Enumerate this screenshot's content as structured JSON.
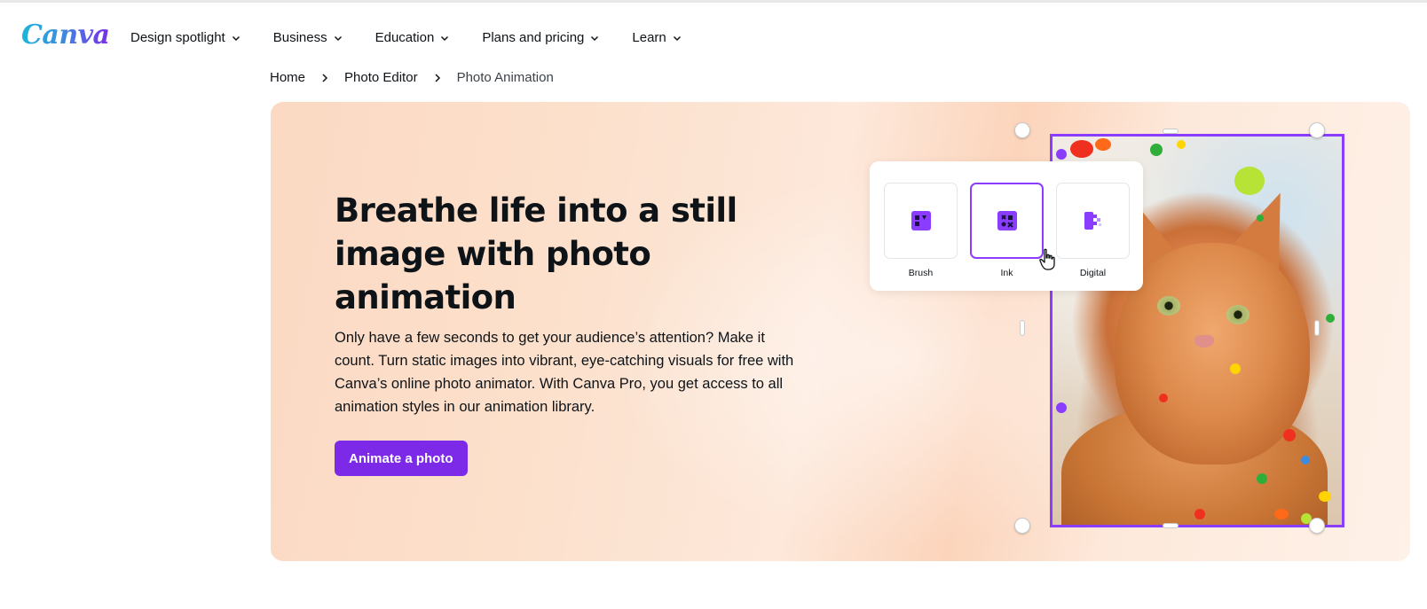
{
  "header": {
    "logo_text": "Canva",
    "nav": [
      {
        "label": "Design spotlight"
      },
      {
        "label": "Business"
      },
      {
        "label": "Education"
      },
      {
        "label": "Plans and pricing"
      },
      {
        "label": "Learn"
      }
    ]
  },
  "breadcrumb": [
    {
      "label": "Home"
    },
    {
      "label": "Photo Editor"
    },
    {
      "label": "Photo Animation"
    }
  ],
  "hero": {
    "title": "Breathe life into a still image with photo animation",
    "description": "Only have a few seconds to get your audience’s attention? Make it count. Turn static images into vibrant, eye-catching visuals for free with Canva’s online photo animator. With Canva Pro, you get access to all animation styles in our animation library.",
    "cta_label": "Animate a photo"
  },
  "animation_styles": {
    "selected": "Ink",
    "options": [
      {
        "label": "Brush",
        "icon": "brush-style-icon"
      },
      {
        "label": "Ink",
        "icon": "ink-style-icon"
      },
      {
        "label": "Digital",
        "icon": "digital-style-icon"
      }
    ]
  },
  "colors": {
    "brand_purple": "#7d2ae8",
    "selection_purple": "#8b3dff",
    "hero_peach": "#fcd4bb"
  }
}
